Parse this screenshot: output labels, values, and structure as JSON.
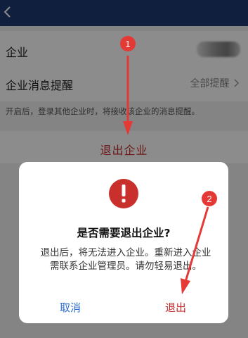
{
  "header": {
    "back_icon": "chevron-left-icon"
  },
  "settings": {
    "company_label": "企业",
    "remind_label": "企业消息提醒",
    "remind_value": "全部提醒",
    "hint": "开启后，登录其他企业时，将接收该企业的消息提醒。",
    "exit_label": "退出企业"
  },
  "dialog": {
    "icon": "exclamation-icon",
    "title": "是否需要退出企业?",
    "message": "退出后，将无法进入企业。重新进入企业需联系企业管理员。请勿轻易退出。",
    "cancel_label": "取消",
    "confirm_label": "退出"
  },
  "annotations": {
    "step1": "1",
    "step2": "2"
  },
  "colors": {
    "header": "#1f3a73",
    "accent_red": "#c32b2b",
    "link_blue": "#2a6ccb"
  }
}
